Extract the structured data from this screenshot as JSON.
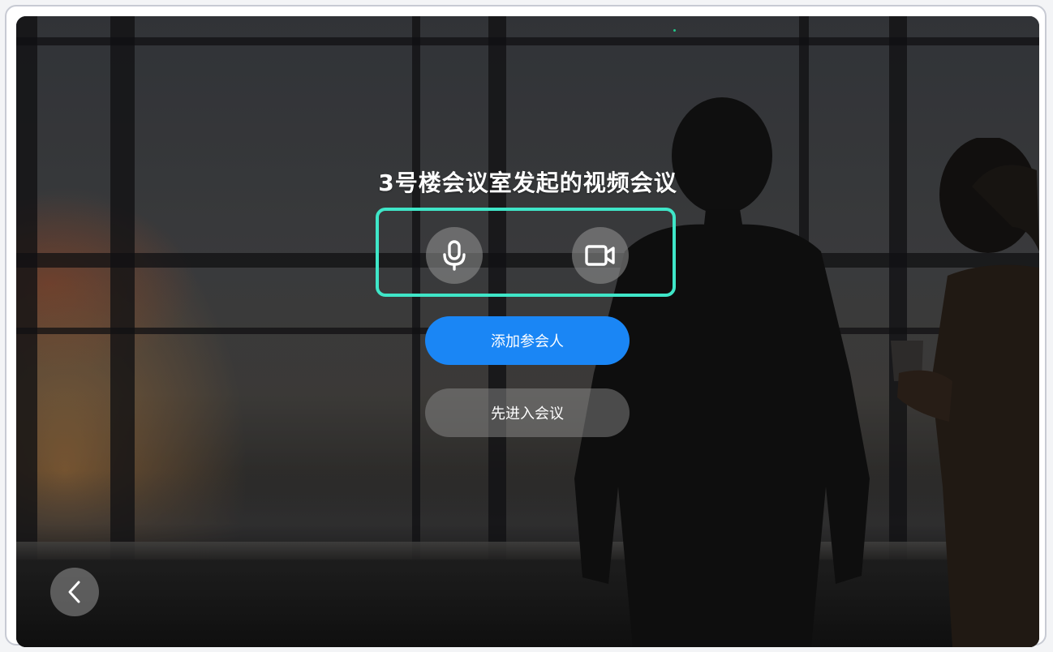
{
  "meeting": {
    "title": "3号楼会议室发起的视频会议"
  },
  "controls": {
    "microphone_icon": "microphone-icon",
    "camera_icon": "video-camera-icon"
  },
  "actions": {
    "add_participants_label": "添加参会人",
    "enter_meeting_label": "先进入会议"
  },
  "navigation": {
    "back_icon": "chevron-left-icon"
  },
  "colors": {
    "highlight_border": "#3fe6c8",
    "primary_button": "#1a86f5",
    "secondary_button": "rgba(150,150,150,0.45)",
    "status_dot": "#22c98a"
  }
}
